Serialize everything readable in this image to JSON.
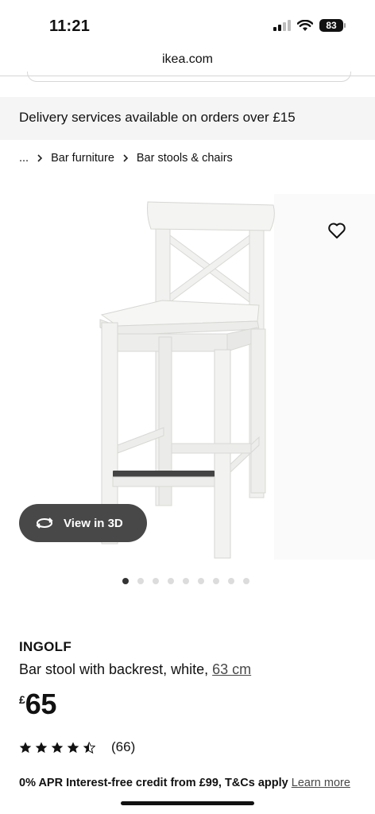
{
  "status_bar": {
    "time": "11:21",
    "battery": "83"
  },
  "browser": {
    "url": "ikea.com"
  },
  "banner": {
    "text": "Delivery services available on orders over £15"
  },
  "breadcrumb": {
    "ellipsis": "...",
    "items": [
      "Bar furniture",
      "Bar stools & chairs"
    ]
  },
  "gallery": {
    "view_3d_label": "View in 3D",
    "image_count": 9,
    "active_index": 0
  },
  "product": {
    "name": "INGOLF",
    "description": "Bar stool with backrest, white,",
    "size_link": "63 cm",
    "currency": "£",
    "price": "65",
    "rating": 4.5,
    "review_count": "(66)"
  },
  "credit": {
    "text": "0% APR Interest-free credit from £99, T&Cs apply",
    "link": "Learn more"
  },
  "icons": {
    "favourite": "heart-icon",
    "view_3d": "rotate-3d-icon",
    "breadcrumb_separator": "chevron-right-icon",
    "rating": "star-icon"
  },
  "colors": {
    "banner_bg": "#f5f5f5",
    "pill_bg": "#484848",
    "dot_active": "#333333",
    "dot_inactive": "#dcdcdc"
  }
}
